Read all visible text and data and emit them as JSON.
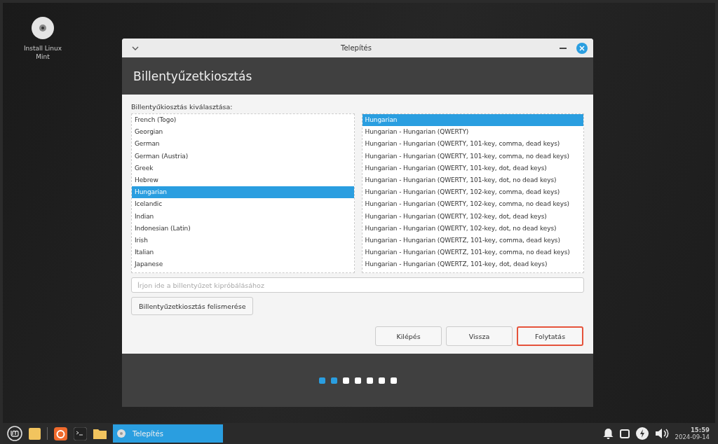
{
  "desktop_icons": [
    {
      "label": "Install Linux Mint"
    }
  ],
  "window": {
    "title": "Telepítés",
    "heading": "Billentyűzetkiosztás",
    "prompt": "Billentyűkiosztás kiválasztása:",
    "layouts": [
      {
        "label": "French (Togo)",
        "selected": false
      },
      {
        "label": "Georgian",
        "selected": false
      },
      {
        "label": "German",
        "selected": false
      },
      {
        "label": "German (Austria)",
        "selected": false
      },
      {
        "label": "Greek",
        "selected": false
      },
      {
        "label": "Hebrew",
        "selected": false
      },
      {
        "label": "Hungarian",
        "selected": true
      },
      {
        "label": "Icelandic",
        "selected": false
      },
      {
        "label": "Indian",
        "selected": false
      },
      {
        "label": "Indonesian (Latin)",
        "selected": false
      },
      {
        "label": "Irish",
        "selected": false
      },
      {
        "label": "Italian",
        "selected": false
      },
      {
        "label": "Japanese",
        "selected": false
      }
    ],
    "variants": [
      {
        "label": "Hungarian",
        "selected": true
      },
      {
        "label": "Hungarian - Hungarian (QWERTY)",
        "selected": false
      },
      {
        "label": "Hungarian - Hungarian (QWERTY, 101-key, comma, dead keys)",
        "selected": false
      },
      {
        "label": "Hungarian - Hungarian (QWERTY, 101-key, comma, no dead keys)",
        "selected": false
      },
      {
        "label": "Hungarian - Hungarian (QWERTY, 101-key, dot, dead keys)",
        "selected": false
      },
      {
        "label": "Hungarian - Hungarian (QWERTY, 101-key, dot, no dead keys)",
        "selected": false
      },
      {
        "label": "Hungarian - Hungarian (QWERTY, 102-key, comma, dead keys)",
        "selected": false
      },
      {
        "label": "Hungarian - Hungarian (QWERTY, 102-key, comma, no dead keys)",
        "selected": false
      },
      {
        "label": "Hungarian - Hungarian (QWERTY, 102-key, dot, dead keys)",
        "selected": false
      },
      {
        "label": "Hungarian - Hungarian (QWERTY, 102-key, dot, no dead keys)",
        "selected": false
      },
      {
        "label": "Hungarian - Hungarian (QWERTZ, 101-key, comma, dead keys)",
        "selected": false
      },
      {
        "label": "Hungarian - Hungarian (QWERTZ, 101-key, comma, no dead keys)",
        "selected": false
      },
      {
        "label": "Hungarian - Hungarian (QWERTZ, 101-key, dot, dead keys)",
        "selected": false
      }
    ],
    "test_field": {
      "placeholder": "Írjon ide a billentyűzet kipróbálásához"
    },
    "detect_button": "Billentyűzetkiosztás felismerése",
    "buttons": [
      {
        "label": "Kilépés",
        "suggested": false
      },
      {
        "label": "Vissza",
        "suggested": false
      },
      {
        "label": "Folytatás",
        "suggested": true
      }
    ],
    "steps": [
      {
        "done": true
      },
      {
        "done": true
      },
      {
        "done": false
      },
      {
        "done": false
      },
      {
        "done": false
      },
      {
        "done": false
      },
      {
        "done": false
      }
    ]
  },
  "taskbar": {
    "window_button": "Telepítés",
    "time": "15:59",
    "date": "2024-09-14"
  }
}
